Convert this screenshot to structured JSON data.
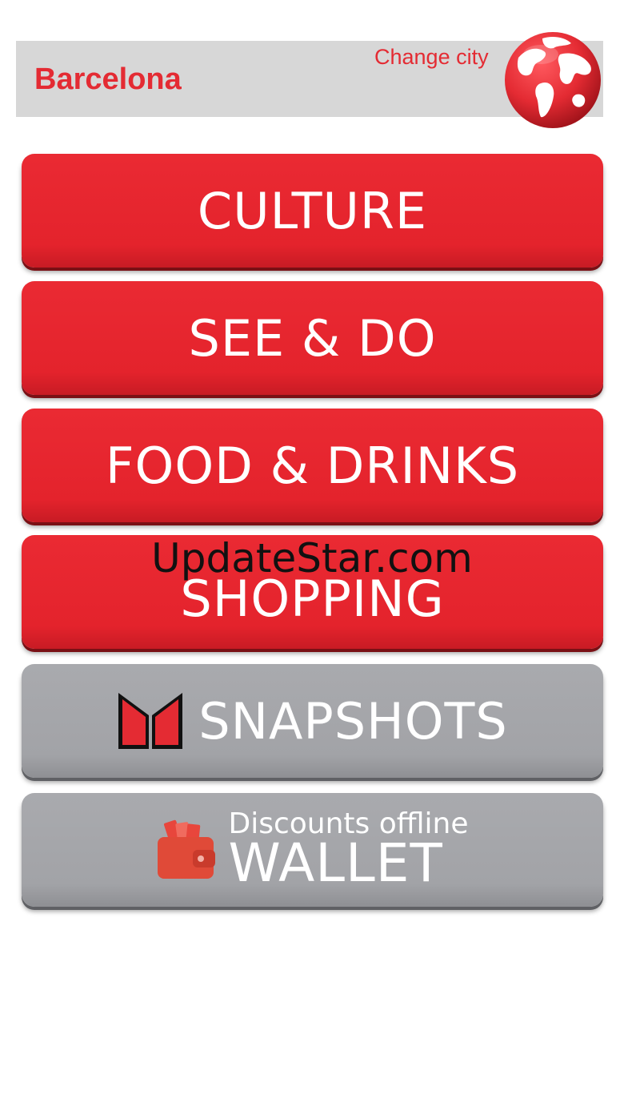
{
  "header": {
    "city": "Barcelona",
    "change_city_label": "Change city"
  },
  "menu": {
    "culture": "CULTURE",
    "see_do": "SEE & DO",
    "food_drinks": "FOOD & DRINKS",
    "shopping": "SHOPPING",
    "snapshots": "SNAPSHOTS",
    "wallet_sub": "Discounts offline",
    "wallet_main": "WALLET"
  },
  "watermark": "UpdateStar.com",
  "colors": {
    "accent_red": "#e42b33",
    "button_gray": "#a5a6aa",
    "header_bg": "#d7d7d7"
  },
  "icons": {
    "globe": "globe-icon",
    "snapshots": "snapshots-logo-icon",
    "wallet": "wallet-icon"
  }
}
